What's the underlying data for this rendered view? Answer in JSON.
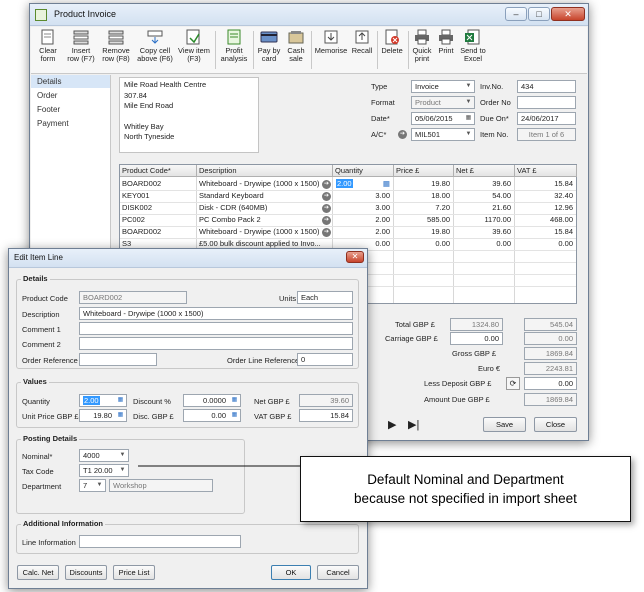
{
  "main_window": {
    "title": "Product Invoice",
    "toolbar": [
      {
        "label": "Clear form"
      },
      {
        "label": "Insert row (F7)"
      },
      {
        "label": "Remove row (F8)"
      },
      {
        "label": "Copy cell above (F6)"
      },
      {
        "label": "View item (F3)"
      },
      {
        "label": "Profit analysis"
      },
      {
        "label": "Pay by card"
      },
      {
        "label": "Cash sale"
      },
      {
        "label": "Memorise"
      },
      {
        "label": "Recall"
      },
      {
        "label": "Delete"
      },
      {
        "label": "Quick print"
      },
      {
        "label": "Print"
      },
      {
        "label": "Send to Excel"
      }
    ],
    "nav": [
      "Details",
      "Order",
      "Footer",
      "Payment"
    ],
    "address": [
      "Mile Road Health Centre",
      "307.84",
      "Mile End Road",
      "",
      "Whitley Bay",
      "North Tyneside"
    ],
    "type_label": "Type",
    "type_value": "Invoice",
    "invno_label": "Inv.No.",
    "invno_value": "434",
    "format_label": "Format",
    "format_value": "Product",
    "orderno_label": "Order No",
    "date_label": "Date*",
    "date_value": "05/06/2015",
    "dueon_label": "Due On*",
    "dueon_value": "24/06/2017",
    "ac_label": "A/C*",
    "ac_value": "MIL501",
    "itemno_label": "Item No.",
    "itemno_value": "Item 1 of 6",
    "grid_headers": [
      "Product Code*",
      "Description",
      "Quantity",
      "Price £",
      "Net £",
      "VAT £"
    ],
    "rows": [
      {
        "code": "BOARD002",
        "desc": "Whiteboard - Drywipe (1000 x 1500)",
        "qty": "2.00",
        "price": "19.80",
        "net": "39.60",
        "vat": "15.84"
      },
      {
        "code": "KEY001",
        "desc": "Standard Keyboard",
        "qty": "3.00",
        "price": "18.00",
        "net": "54.00",
        "vat": "32.40"
      },
      {
        "code": "DISK002",
        "desc": "Disk - CDR (640MB)",
        "qty": "3.00",
        "price": "7.20",
        "net": "21.60",
        "vat": "12.96"
      },
      {
        "code": "PC002",
        "desc": "PC Combo Pack 2",
        "qty": "2.00",
        "price": "585.00",
        "net": "1170.00",
        "vat": "468.00"
      },
      {
        "code": "BOARD002",
        "desc": "Whiteboard - Drywipe (1000 x 1500)",
        "qty": "2.00",
        "price": "19.80",
        "net": "39.60",
        "vat": "15.84"
      },
      {
        "code": "S3",
        "desc": "£5.00 bulk discount applied to Invo...",
        "qty": "0.00",
        "price": "0.00",
        "net": "0.00",
        "vat": "0.00"
      }
    ],
    "totals": {
      "total_label": "Total GBP £",
      "total_net": "1324.80",
      "total_vat": "545.04",
      "carriage_label": "Carriage GBP £",
      "carriage_net": "0.00",
      "carriage_vat": "0.00",
      "gross_label": "Gross GBP £",
      "gross_value": "1869.84",
      "euro_label": "Euro €",
      "euro_value": "2243.81",
      "deposit_label": "Less Deposit GBP £",
      "deposit_value": "0.00",
      "amountdue_label": "Amount Due GBP £",
      "amountdue_value": "1869.84"
    },
    "save_label": "Save",
    "close_label": "Close"
  },
  "dialog": {
    "title": "Edit Item Line",
    "details_title": "Details",
    "product_code_label": "Product Code",
    "product_code_value": "BOARD002",
    "units_label": "Units",
    "units_value": "Each",
    "description_label": "Description",
    "description_value": "Whiteboard - Drywipe (1000 x 1500)",
    "comment1_label": "Comment 1",
    "comment2_label": "Comment 2",
    "order_ref_label": "Order Reference",
    "order_line_ref_label": "Order Line Reference",
    "order_line_ref_value": "0",
    "values_title": "Values",
    "quantity_label": "Quantity",
    "quantity_value": "2.00",
    "discount_pct_label": "Discount %",
    "discount_pct_value": "0.0000",
    "net_label": "Net GBP £",
    "net_value": "39.60",
    "unit_price_label": "Unit Price GBP £",
    "unit_price_value": "19.80",
    "disc_label": "Disc. GBP £",
    "disc_value": "0.00",
    "vat_label": "VAT GBP £",
    "vat_value": "15.84",
    "posting_title": "Posting Details",
    "nominal_label": "Nominal*",
    "nominal_value": "4000",
    "taxcode_label": "Tax Code",
    "taxcode_value": "T1 20.00",
    "department_label": "Department",
    "department_value": "7",
    "department_name": "Workshop",
    "additional_title": "Additional Information",
    "line_info_label": "Line Information",
    "calc_net": "Calc. Net",
    "discounts": "Discounts",
    "price_list": "Price List",
    "ok": "OK",
    "cancel": "Cancel"
  },
  "callout": {
    "line1": "Default Nominal and Department",
    "line2": "because not specified in import sheet"
  }
}
